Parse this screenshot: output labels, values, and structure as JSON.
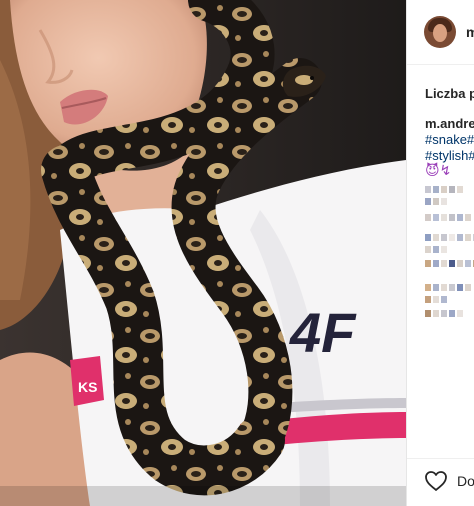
{
  "post": {
    "username": "m",
    "likes_label": "Liczba po",
    "caption_username": "m.andrej",
    "hashtags": [
      "#snake#",
      "#stylish#"
    ],
    "emoji": "😈↯"
  },
  "actions": {
    "like_label": "Doo",
    "like_icon": "heart-outline-icon"
  },
  "photo": {
    "shirt_logo": "4F",
    "sleeve_text": "KS"
  },
  "colors": {
    "username": "#262626",
    "hashtag": "#003569",
    "stripe": "#e0306b",
    "snake_dark": "#1b1613",
    "snake_light": "#c9ad78"
  }
}
